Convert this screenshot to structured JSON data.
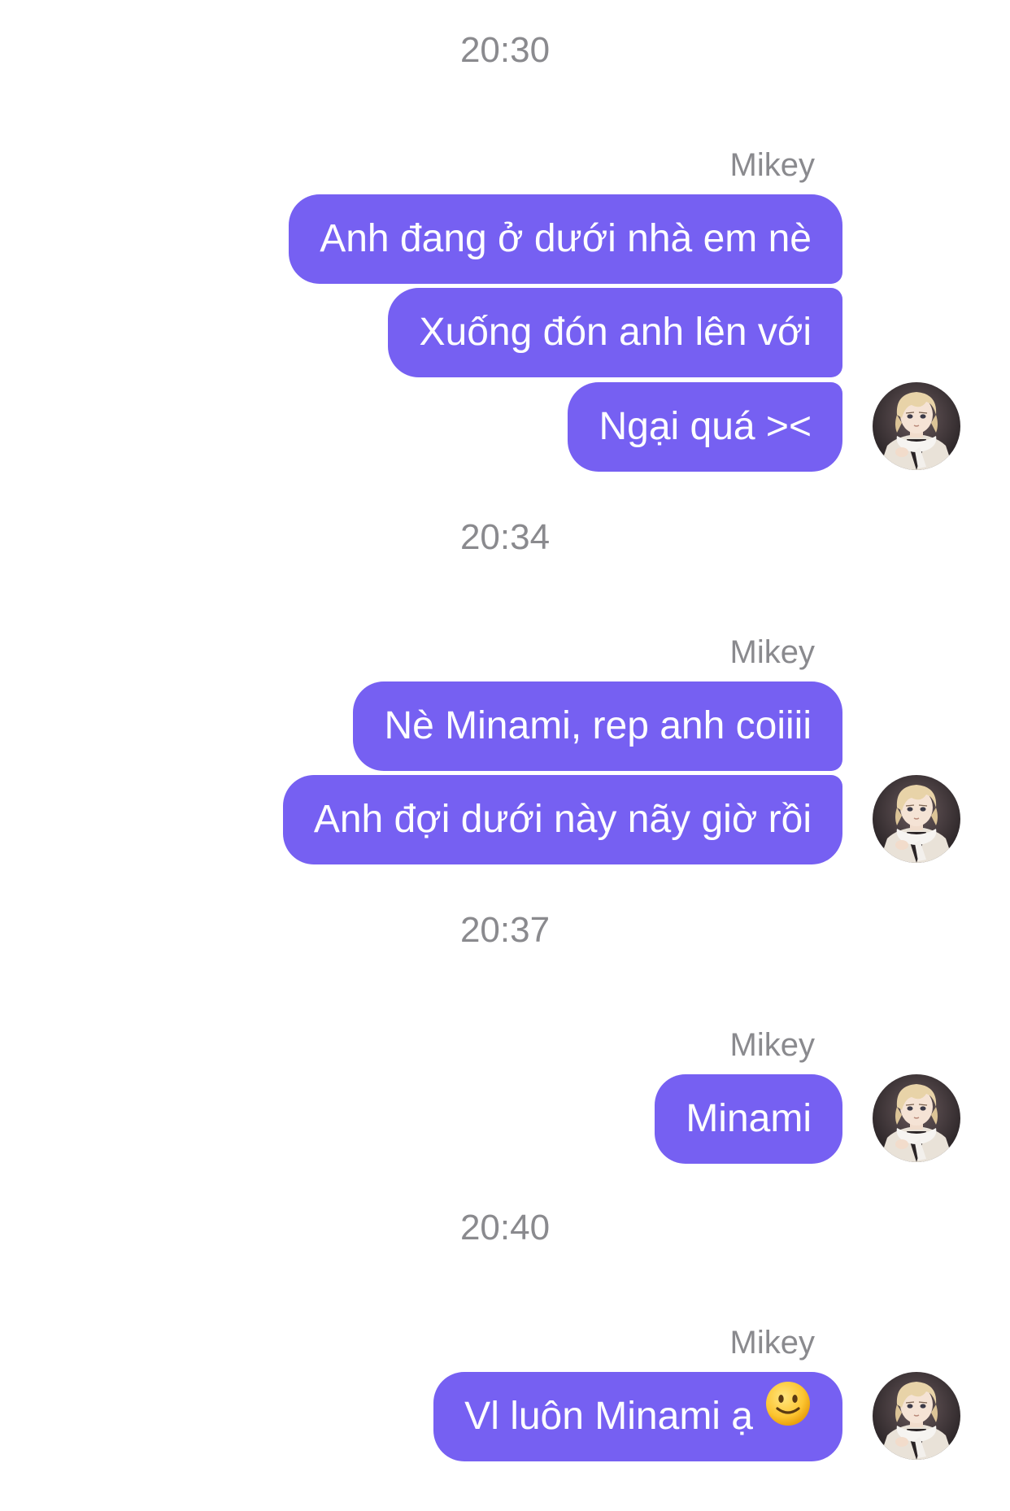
{
  "colors": {
    "bubble": "#7660f2",
    "bubble_text": "#ffffff",
    "meta_text": "#8a8a8e",
    "background": "#ffffff"
  },
  "groups": [
    {
      "time": "20:30",
      "sender": "Mikey",
      "messages": [
        "Anh đang ở dưới nhà em nè",
        "Xuống đón anh lên với",
        "Ngại quá ><"
      ]
    },
    {
      "time": "20:34",
      "sender": "Mikey",
      "messages": [
        "Nè Minami, rep anh coiiii",
        "Anh đợi dưới này nãy giờ rồi"
      ]
    },
    {
      "time": "20:37",
      "sender": "Mikey",
      "messages": [
        "Minami"
      ]
    },
    {
      "time": "20:40",
      "sender": "Mikey",
      "messages": [
        "Vl luôn Minami ạ"
      ],
      "emoji": "slightly-smiling-face-icon"
    }
  ],
  "avatar_icon": "anime-avatar-icon"
}
